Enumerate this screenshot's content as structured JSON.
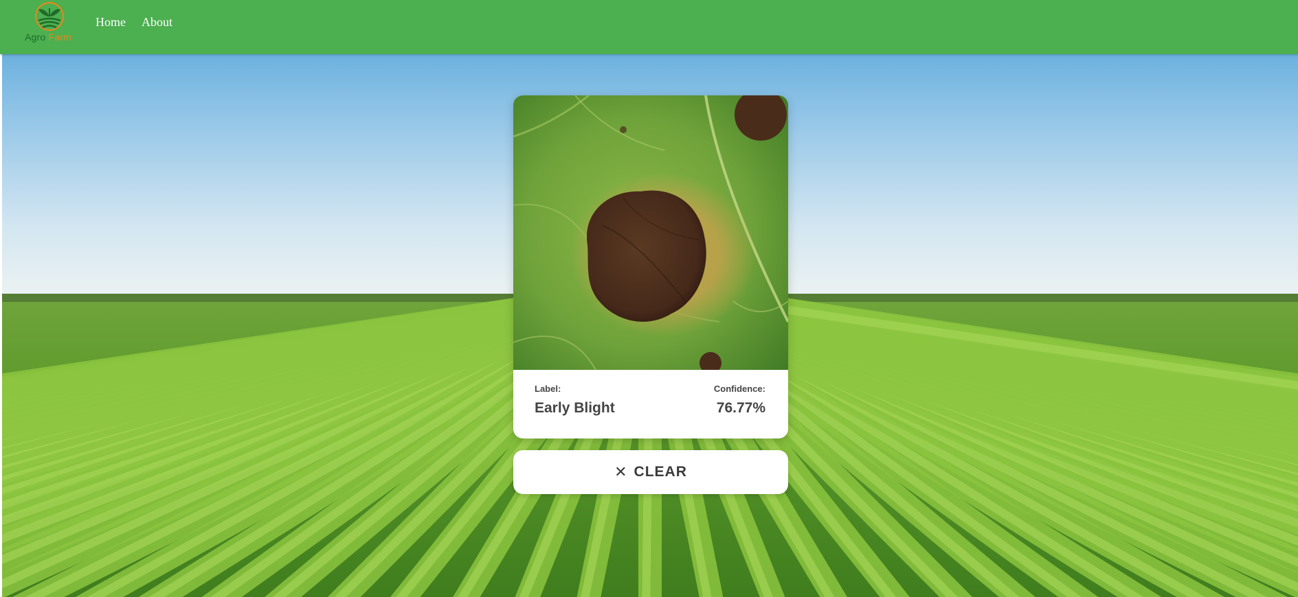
{
  "navbar": {
    "logo_word_1": "Agro",
    "logo_word_2": "Farm",
    "links": [
      {
        "label": "Home"
      },
      {
        "label": "About"
      }
    ]
  },
  "result": {
    "label_caption": "Label:",
    "label_value": "Early Blight",
    "confidence_caption": "Confidence:",
    "confidence_value": "76.77%"
  },
  "clear_button": {
    "icon": "close-icon",
    "label": "CLEAR"
  },
  "colors": {
    "header_bg": "#4caf50",
    "logo_green": "#1e6b2a",
    "logo_orange": "#e08a1e",
    "text_dark": "#444444"
  }
}
